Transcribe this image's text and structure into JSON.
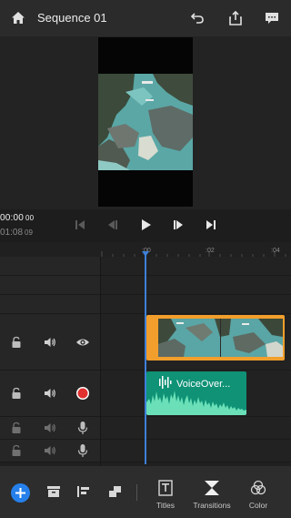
{
  "header": {
    "title": "Sequence 01",
    "icons": [
      "home-icon",
      "undo-icon",
      "share-icon",
      "comment-icon"
    ]
  },
  "transport": {
    "current_time": "00:00",
    "current_frames": "00",
    "total_time": "01:08",
    "total_frames": "09"
  },
  "ruler": {
    "ticks": [
      ":00",
      ":02",
      ":04"
    ]
  },
  "tracks": [
    {
      "type": "video",
      "icons": [
        "lock-icon",
        "volume-icon",
        "eye-icon"
      ]
    },
    {
      "type": "audio",
      "icons": [
        "lock-icon",
        "volume-icon",
        "record-icon"
      ]
    },
    {
      "type": "audio",
      "icons": [
        "lock-icon",
        "volume-icon",
        "microphone-icon"
      ]
    },
    {
      "type": "audio",
      "icons": [
        "lock-icon",
        "volume-icon",
        "microphone-icon"
      ]
    }
  ],
  "clips": {
    "audio_clip_label": "VoiceOver..."
  },
  "toolbar": {
    "titles_label": "Titles",
    "transitions_label": "Transitions",
    "color_label": "Color"
  },
  "colors": {
    "accent_blue": "#2680eb",
    "playhead": "#3d7fd9",
    "video_clip_border": "#f29e2c",
    "audio_clip": "#0f9276",
    "record_red": "#e03030"
  }
}
